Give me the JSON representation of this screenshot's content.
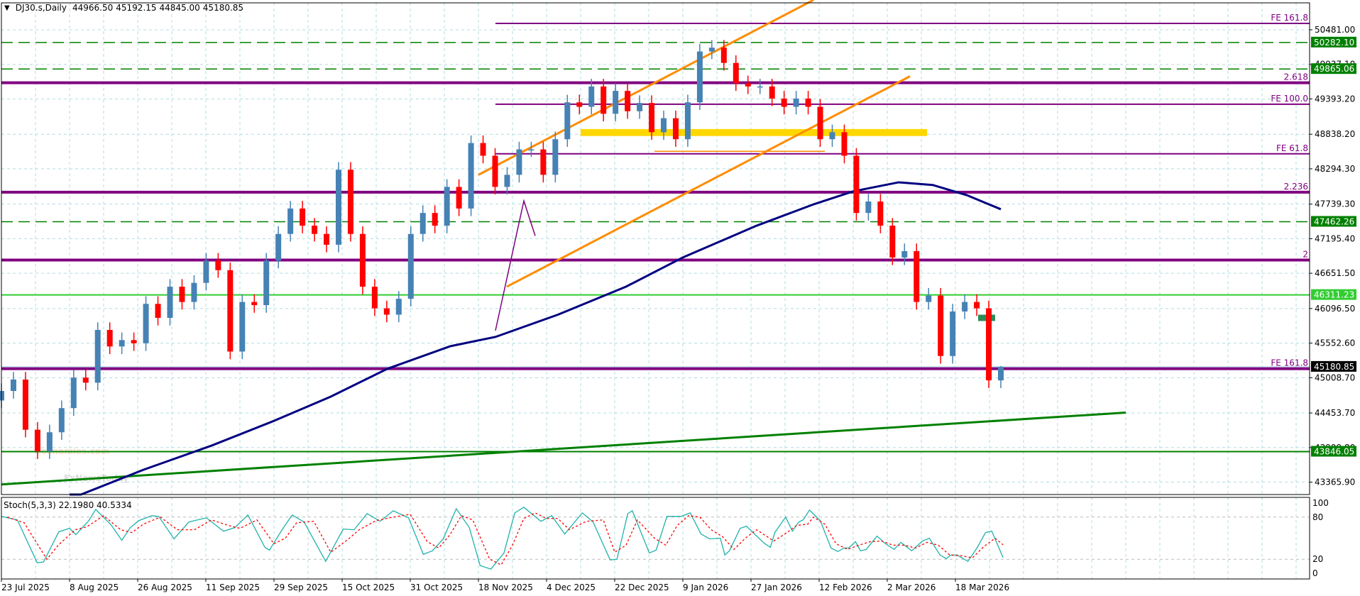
{
  "header": {
    "dropdown_icon": "triangle-down-icon",
    "symbol": "DJ30.s,Daily",
    "open": "44966.50",
    "high": "45192.15",
    "low": "44845.00",
    "close": "45180.85"
  },
  "watermark": {
    "line1": "economies.com",
    "line2": "FxNewsToday"
  },
  "colors": {
    "bull": "#4682b4",
    "bear": "#ff0000",
    "grid": "#b0dde0",
    "fib": "#800080",
    "level_green": "#008000",
    "level_lime": "#32cd32",
    "ma": "#000080",
    "channel": "#ff8c00",
    "zone": "#ffd700",
    "stoch_k": "#20b2aa",
    "stoch_d": "#ff0000"
  },
  "chart_data": [
    {
      "type": "candlestick",
      "title": "DJ30.s,Daily",
      "ylim": [
        43180,
        50950
      ],
      "x_range_days": [
        0,
        176
      ],
      "price_ticks": [
        "50481.00",
        "49937.10",
        "49393.20",
        "48838.20",
        "48294.30",
        "47739.30",
        "47195.40",
        "46651.50",
        "46096.50",
        "45552.60",
        "45008.70",
        "44453.70",
        "43909.80",
        "43365.90"
      ],
      "date_ticks": [
        "23 Jul 2025",
        "8 Aug 2025",
        "26 Aug 2025",
        "11 Sep 2025",
        "29 Sep 2025",
        "15 Oct 2025",
        "31 Oct 2025",
        "18 Nov 2025",
        "4 Dec 2025",
        "22 Dec 2025",
        "9 Jan 2026",
        "27 Jan 2026",
        "12 Feb 2026",
        "2 Mar 2026",
        "18 Mar 2026"
      ],
      "closes": [
        44800,
        44980,
        44190,
        43850,
        44150,
        44530,
        45010,
        44930,
        45760,
        45500,
        45600,
        45550,
        46170,
        45950,
        46440,
        46200,
        46500,
        46850,
        46700,
        45420,
        46200,
        46150,
        46850,
        47270,
        47670,
        47400,
        47270,
        47100,
        48280,
        47270,
        46440,
        46100,
        46000,
        46250,
        47270,
        47600,
        47400,
        48010,
        47670,
        48700,
        48500,
        48010,
        48200,
        48600,
        48600,
        48200,
        48760,
        49340,
        49270,
        49590,
        49160,
        49520,
        49200,
        49330,
        48870,
        49090,
        48760,
        49340,
        50140,
        50200,
        49960,
        49640,
        49590,
        49590,
        49400,
        49270,
        49400,
        49270,
        48760,
        48870,
        48500,
        47600,
        47780,
        47400,
        46900,
        47000,
        46200,
        46300,
        45350,
        46050,
        46200,
        46100,
        44966.5
      ],
      "last_bar": {
        "open": 44966.5,
        "high": 45192.15,
        "low": 44845.0,
        "close": 45180.85
      },
      "moving_average": [
        [
          12,
          43000
        ],
        [
          14,
          43170
        ],
        [
          25,
          43560
        ],
        [
          37,
          43940
        ],
        [
          48,
          44330
        ],
        [
          58,
          44711
        ],
        [
          68,
          45150
        ],
        [
          79,
          45503
        ],
        [
          87,
          45650
        ],
        [
          98,
          46000
        ],
        [
          110,
          46441
        ],
        [
          120,
          46900
        ],
        [
          133,
          47400
        ],
        [
          143,
          47735
        ],
        [
          150,
          47940
        ],
        [
          158,
          48082
        ],
        [
          164,
          48040
        ],
        [
          170,
          47880
        ],
        [
          176,
          47658
        ]
      ],
      "levels": [
        {
          "price": 50581,
          "label": "FE 161.8",
          "kind": "fib-thin",
          "from_day": 87
        },
        {
          "price": 50282.1,
          "label": "50282.10",
          "kind": "green-dashed"
        },
        {
          "price": 49865.06,
          "label": "49865.06",
          "kind": "green-dashed"
        },
        {
          "price": 49648,
          "label": "2.618",
          "kind": "fib-thick"
        },
        {
          "price": 49310,
          "label": "FE 100.0",
          "kind": "fib-thin",
          "from_day": 87
        },
        {
          "price": 48530,
          "label": "FE 61.8",
          "kind": "fib-thin",
          "from_day": 87
        },
        {
          "price": 47927,
          "label": "2.236",
          "kind": "fib-thick"
        },
        {
          "price": 47462.26,
          "label": "47462.26",
          "kind": "green-dashed"
        },
        {
          "price": 46860,
          "label": "2",
          "kind": "fib-thick"
        },
        {
          "price": 46311.23,
          "label": "46311.23",
          "kind": "lime-solid"
        },
        {
          "price": 45150,
          "label": "FE 161.8",
          "kind": "fib-thick"
        },
        {
          "price": 45180.85,
          "label": "45180.85",
          "kind": "current"
        },
        {
          "price": 43846.05,
          "label": "43846.05",
          "kind": "green-solid"
        }
      ],
      "channel": {
        "upper": [
          [
            84,
            48200
          ],
          [
            143,
            50950
          ]
        ],
        "lower": [
          [
            89,
            46440
          ],
          [
            160,
            49750
          ]
        ]
      },
      "trendline": [
        [
          0,
          43330
        ],
        [
          198,
          44460
        ]
      ],
      "zigzag": [
        [
          87,
          45750
        ],
        [
          92,
          47790
        ],
        [
          94,
          47240
        ]
      ],
      "zone": {
        "from_day": 102,
        "to_day": 163,
        "top": 48920,
        "bottom": 48810
      },
      "zone_line": {
        "from_day": 115,
        "to_day": 145,
        "price": 48570
      },
      "marker_box": {
        "from_day": 172,
        "to_day": 175,
        "top": 46000,
        "bottom": 45900
      }
    },
    {
      "type": "line",
      "title": "Stoch(5,3,3) 22.1980 40.5334",
      "label": "Stoch(5,3,3) 22.1980 40.5334",
      "ylim": [
        0,
        100
      ],
      "ticks": [
        "100",
        "80",
        "20",
        "0"
      ],
      "k": [
        [
          0,
          81
        ],
        [
          2.8,
          76
        ],
        [
          6.3,
          15
        ],
        [
          7.4,
          16
        ],
        [
          10.1,
          59
        ],
        [
          12,
          64
        ],
        [
          13.1,
          55
        ],
        [
          15.4,
          75
        ],
        [
          16.6,
          91
        ],
        [
          19.3,
          69
        ],
        [
          21.2,
          47
        ],
        [
          22.7,
          65
        ],
        [
          24.2,
          75
        ],
        [
          26.5,
          82
        ],
        [
          27.7,
          81
        ],
        [
          30.4,
          49
        ],
        [
          33,
          73
        ],
        [
          36.1,
          79
        ],
        [
          39.1,
          60
        ],
        [
          41.1,
          65
        ],
        [
          43.4,
          83
        ],
        [
          46.4,
          37
        ],
        [
          47.2,
          33
        ],
        [
          49.5,
          63
        ],
        [
          51.2,
          83
        ],
        [
          53.3,
          73
        ],
        [
          57.1,
          17
        ],
        [
          60.2,
          63
        ],
        [
          62.1,
          62
        ],
        [
          64.4,
          85
        ],
        [
          66.7,
          74
        ],
        [
          69,
          89
        ],
        [
          71.7,
          79
        ],
        [
          74.3,
          27
        ],
        [
          75.9,
          32
        ],
        [
          77.8,
          49
        ],
        [
          80.1,
          92
        ],
        [
          82.4,
          65
        ],
        [
          84.3,
          11
        ],
        [
          86.2,
          6
        ],
        [
          88.5,
          29
        ],
        [
          90.4,
          86
        ],
        [
          92,
          94
        ],
        [
          95,
          74
        ],
        [
          96.9,
          82
        ],
        [
          99.2,
          56
        ],
        [
          102.3,
          86
        ],
        [
          104.2,
          73
        ],
        [
          107.2,
          19
        ],
        [
          108.4,
          20
        ],
        [
          110.3,
          85
        ],
        [
          111.1,
          89
        ],
        [
          114.1,
          29
        ],
        [
          115.3,
          33
        ],
        [
          117.2,
          81
        ],
        [
          119.7,
          81
        ],
        [
          121.3,
          86
        ],
        [
          123.2,
          56
        ],
        [
          124.7,
          49
        ],
        [
          126.6,
          50
        ],
        [
          127.4,
          26
        ],
        [
          128.2,
          32
        ],
        [
          130.1,
          64
        ],
        [
          131.2,
          67
        ],
        [
          134.3,
          43
        ],
        [
          135.4,
          37
        ],
        [
          136.2,
          58
        ],
        [
          138.1,
          80
        ],
        [
          139.3,
          60
        ],
        [
          140.4,
          73
        ],
        [
          141.2,
          76
        ],
        [
          142.3,
          90
        ],
        [
          144.2,
          75
        ],
        [
          146.1,
          36
        ],
        [
          147.3,
          31
        ],
        [
          148.4,
          36
        ],
        [
          149.2,
          36
        ],
        [
          150.4,
          45
        ],
        [
          151.3,
          32
        ],
        [
          152.3,
          34
        ],
        [
          154.2,
          53
        ],
        [
          155.7,
          42
        ],
        [
          157.2,
          34
        ],
        [
          158.4,
          44
        ],
        [
          160.3,
          32
        ],
        [
          162.2,
          46
        ],
        [
          163.4,
          50
        ],
        [
          165.3,
          26
        ],
        [
          166.4,
          21
        ],
        [
          167.2,
          26
        ],
        [
          168.3,
          26
        ],
        [
          170.2,
          17
        ],
        [
          171.8,
          36
        ],
        [
          173.3,
          58
        ],
        [
          174.4,
          60
        ],
        [
          176.4,
          22.198
        ]
      ],
      "d": [
        [
          1,
          80
        ],
        [
          4,
          72
        ],
        [
          8,
          20
        ],
        [
          10,
          40
        ],
        [
          13,
          62
        ],
        [
          15,
          66
        ],
        [
          18,
          82
        ],
        [
          21,
          62
        ],
        [
          23,
          58
        ],
        [
          25,
          70
        ],
        [
          28,
          80
        ],
        [
          31,
          62
        ],
        [
          34,
          62
        ],
        [
          37,
          76
        ],
        [
          40,
          68
        ],
        [
          42,
          64
        ],
        [
          45,
          76
        ],
        [
          48,
          42
        ],
        [
          50,
          50
        ],
        [
          52,
          72
        ],
        [
          55,
          74
        ],
        [
          58,
          30
        ],
        [
          61,
          48
        ],
        [
          63,
          62
        ],
        [
          66,
          75
        ],
        [
          69,
          80
        ],
        [
          72,
          84
        ],
        [
          75,
          45
        ],
        [
          77,
          36
        ],
        [
          79,
          55
        ],
        [
          81,
          82
        ],
        [
          83,
          76
        ],
        [
          86,
          20
        ],
        [
          88,
          12
        ],
        [
          90,
          40
        ],
        [
          92,
          78
        ],
        [
          94,
          86
        ],
        [
          96,
          78
        ],
        [
          98,
          78
        ],
        [
          100,
          62
        ],
        [
          103,
          74
        ],
        [
          106,
          76
        ],
        [
          108,
          30
        ],
        [
          110,
          40
        ],
        [
          112,
          76
        ],
        [
          115,
          50
        ],
        [
          117,
          40
        ],
        [
          119,
          68
        ],
        [
          121,
          82
        ],
        [
          123,
          80
        ],
        [
          125,
          62
        ],
        [
          127,
          52
        ],
        [
          129,
          34
        ],
        [
          131,
          50
        ],
        [
          133,
          62
        ],
        [
          136,
          46
        ],
        [
          138,
          56
        ],
        [
          140,
          68
        ],
        [
          142,
          70
        ],
        [
          143,
          80
        ],
        [
          145,
          70
        ],
        [
          147,
          42
        ],
        [
          149,
          34
        ],
        [
          151,
          40
        ],
        [
          153,
          45
        ],
        [
          155,
          46
        ],
        [
          157,
          40
        ],
        [
          159,
          40
        ],
        [
          161,
          36
        ],
        [
          163,
          44
        ],
        [
          165,
          40
        ],
        [
          167,
          26
        ],
        [
          169,
          25
        ],
        [
          171,
          22
        ],
        [
          173,
          38
        ],
        [
          175,
          50
        ],
        [
          176.4,
          40.5334
        ]
      ]
    }
  ]
}
